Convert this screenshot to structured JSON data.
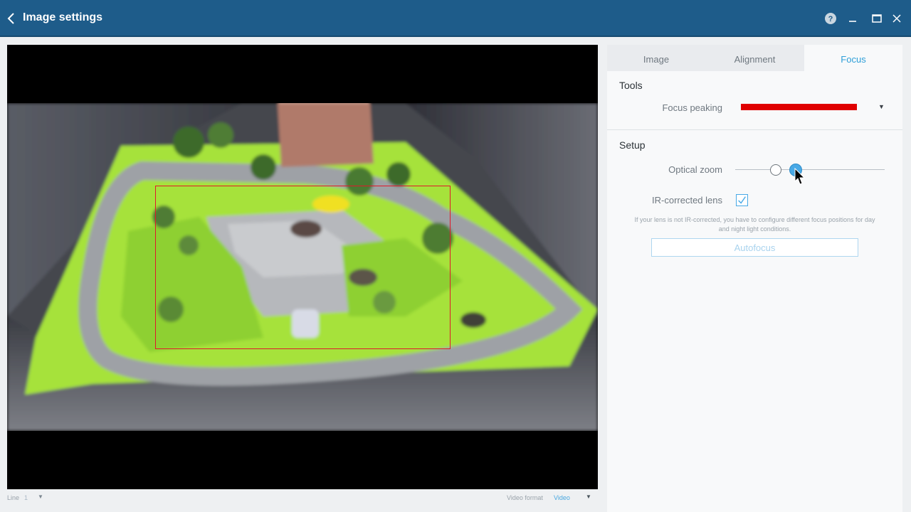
{
  "header": {
    "title": "Image settings",
    "icons": [
      "chevron-left-icon",
      "help-icon",
      "minimize-icon",
      "maximize-icon",
      "close-icon"
    ]
  },
  "video": {
    "footer": {
      "line_label": "Line",
      "line_value": "1",
      "format_label": "Video format",
      "format_value": "Video"
    }
  },
  "panel": {
    "tabs": [
      {
        "label": "Image",
        "active": false
      },
      {
        "label": "Alignment",
        "active": false
      },
      {
        "label": "Focus",
        "active": true
      }
    ],
    "tools": {
      "title": "Tools",
      "focus_peaking_label": "Focus peaking",
      "focus_peaking_color": "#e00000"
    },
    "setup": {
      "title": "Setup",
      "optical_zoom_label": "Optical zoom",
      "ir_lens_label": "IR-corrected lens",
      "ir_lens_checked": true,
      "hint": "If your lens is not IR-corrected, you have to configure different focus positions for day and night light conditions.",
      "autofocus_label": "Autofocus"
    }
  },
  "colors": {
    "titlebar": "#1e5c8a",
    "accent": "#2e9fd8",
    "roi": "#e0182b"
  }
}
